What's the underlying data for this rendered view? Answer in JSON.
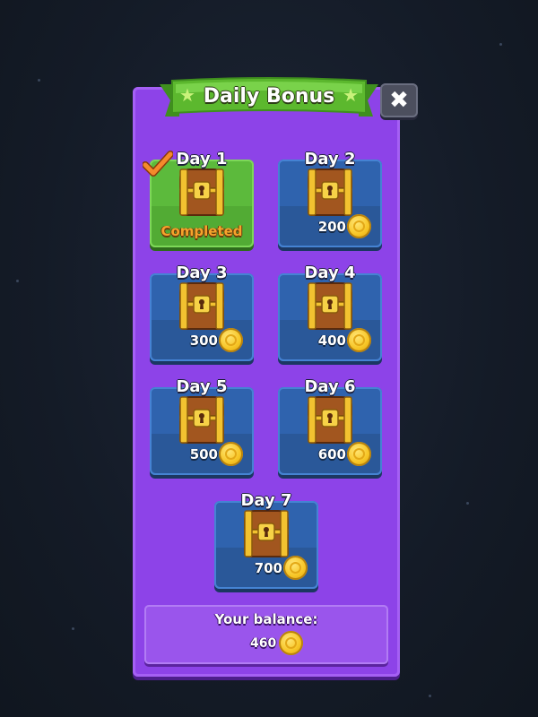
{
  "title": "Daily Bonus",
  "close_label": "✖",
  "days": [
    {
      "label": "Day 1",
      "reward": "",
      "status": "Completed",
      "completed": true
    },
    {
      "label": "Day 2",
      "reward": "200",
      "status": "",
      "completed": false
    },
    {
      "label": "Day 3",
      "reward": "300",
      "status": "",
      "completed": false
    },
    {
      "label": "Day 4",
      "reward": "400",
      "status": "",
      "completed": false
    },
    {
      "label": "Day 5",
      "reward": "500",
      "status": "",
      "completed": false
    },
    {
      "label": "Day 6",
      "reward": "600",
      "status": "",
      "completed": false
    },
    {
      "label": "Day 7",
      "reward": "700",
      "status": "",
      "completed": false
    }
  ],
  "balance": {
    "label": "Your balance:",
    "value": "460"
  },
  "colors": {
    "panel": "#8d43e8",
    "card": "#2f63ae",
    "completed_card": "#5cba3c",
    "ribbon": "#5cb82e",
    "coin": "#f7c525"
  }
}
